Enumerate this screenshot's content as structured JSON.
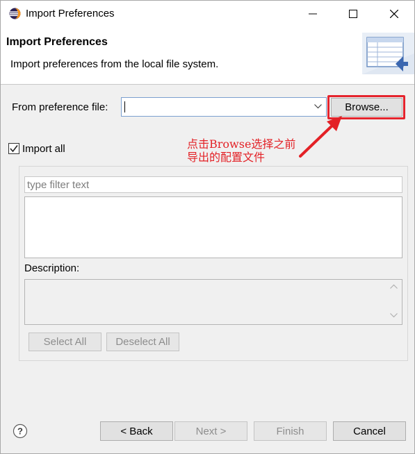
{
  "window": {
    "title": "Import Preferences",
    "controls": [
      "minimize-icon",
      "maximize-icon",
      "close-icon"
    ]
  },
  "header": {
    "title": "Import Preferences",
    "description": "Import preferences from the local file system."
  },
  "form": {
    "from_file_label": "From preference file:",
    "from_file_value": "",
    "browse_label": "Browse...",
    "import_all_label": "Import all",
    "import_all_checked": true,
    "filter_placeholder": "type filter text",
    "description_label": "Description:",
    "select_all_label": "Select All",
    "deselect_all_label": "Deselect All"
  },
  "annotation": {
    "line1": "点击Browse选择之前",
    "line2": "导出的配置文件",
    "color": "#e32126"
  },
  "footer": {
    "back_label": "< Back",
    "next_label": "Next >",
    "finish_label": "Finish",
    "cancel_label": "Cancel"
  },
  "colors": {
    "highlight": "#e5242d",
    "disabled_text": "#8d8d8d"
  }
}
